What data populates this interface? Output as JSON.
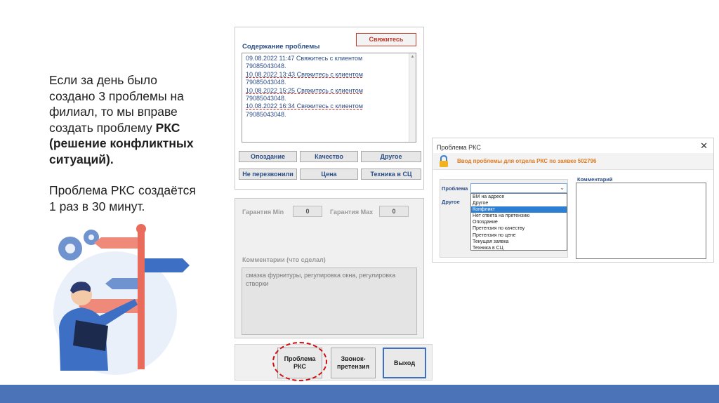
{
  "slide": {
    "para1_text": "Если за день было\nсоздано 3 проблемы на\nфилиал, то мы вправе\nсоздать проблему ",
    "para1_bold": "РКС\n(решение конфликтных\nситуаций).",
    "para2": "Проблема РКС создаётся\n1 раз в 30 минут."
  },
  "problem_panel": {
    "contact_button": "Свяжитесь",
    "section_title": "Содержание проблемы",
    "log_lines": [
      "09.08.2022 11:47 Свяжитесь с клиентом",
      "79085043048.",
      "10.08.2022 13:43 Свяжитесь с клиентом",
      "79085043048.",
      "10.08.2022 15:25 Свяжитесь с клиентом",
      "79085043048.",
      "10.08.2022 16:34 Свяжитесь с клиентом",
      "79085043048."
    ],
    "category_buttons": [
      "Опоздание",
      "Качество",
      "Другое",
      "Не перезвонили",
      "Цена",
      "Техника в СЦ"
    ]
  },
  "guarantee_panel": {
    "min_label": "Гарантия Min",
    "min_value": "0",
    "max_label": "Гарантия Max",
    "max_value": "0",
    "comment_label": "Комментарии (что сделал)",
    "comment_text": "смазка фурнитуры, регулировка окна, регулировка створки"
  },
  "action_buttons": {
    "rks": "Проблема РКС",
    "call": "Звонок-претензия",
    "exit": "Выход"
  },
  "dialog": {
    "title": "Проблема РКС",
    "close": "✕",
    "banner": "Ввод проблемы для отдела РКС по заявке 502796",
    "problem_label": "Проблема",
    "other_label": "Другое",
    "comment_label": "Комментарий",
    "options": [
      "ВМ на адресе",
      "Другое",
      "Конфликт",
      "Нет ответа на претензию",
      "Опоздание",
      "Претензия по качеству",
      "Претензия по цене",
      "Текущая заявка",
      "Техника в СЦ"
    ],
    "selected_option": "Конфликт"
  },
  "colors": {
    "accent_blue": "#4a73b8",
    "label_blue": "#2b4d86",
    "highlight_red": "#d01010",
    "banner_orange": "#e07b22"
  }
}
